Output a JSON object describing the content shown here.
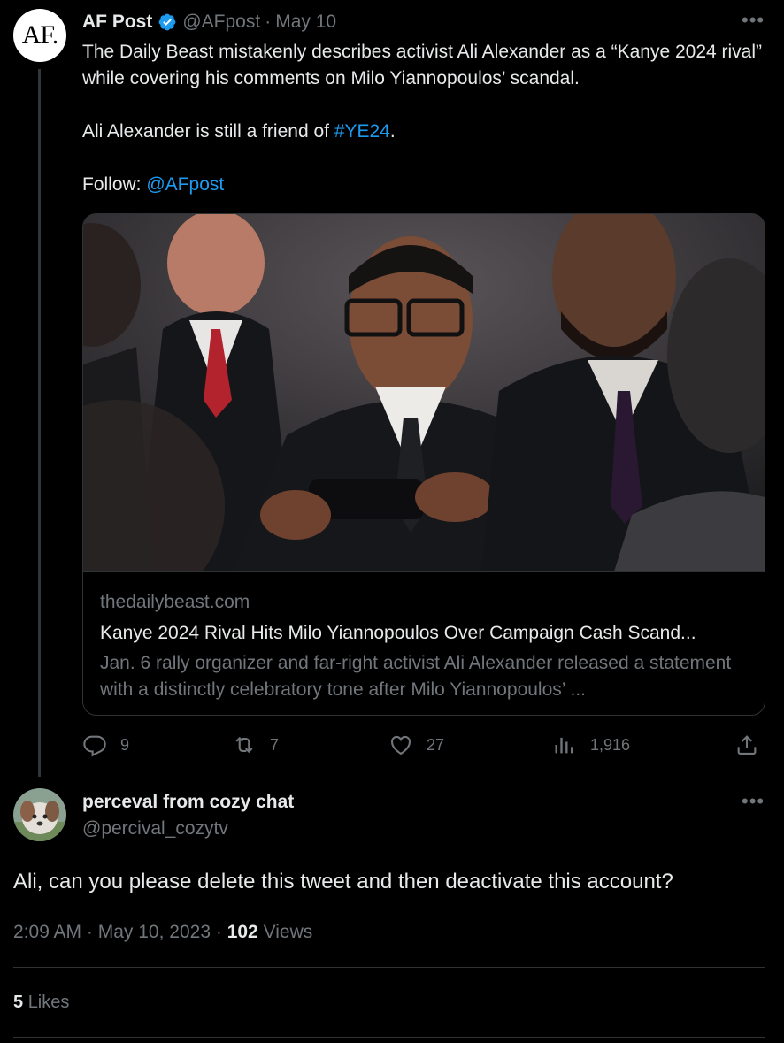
{
  "tweet": {
    "avatar_text": "AF.",
    "author_name": "AF Post",
    "handle": "@AFpost",
    "separator": "·",
    "date": "May 10",
    "more_icon": "more-dots-icon",
    "verified_icon": "verified-badge-icon",
    "verified_color": "#1d9bf0",
    "text_line1": "The Daily Beast mistakenly describes activist Ali Alexander as a “Kanye 2024 rival” while covering his comments on Milo Yiannopoulos’ scandal.",
    "text_line2_prefix": "Ali Alexander is still a friend of ",
    "hashtag": "#YE24",
    "text_line2_suffix": ".",
    "follow_prefix": "Follow: ",
    "follow_handle": "@AFpost",
    "card": {
      "domain": "thedailybeast.com",
      "title": "Kanye 2024 Rival Hits Milo Yiannopoulos Over Campaign Cash Scand...",
      "description": "Jan. 6 rally organizer and far-right activist Ali Alexander released a statement with a distinctly celebratory tone after Milo Yiannopoulos’ ..."
    },
    "actions": {
      "replies": "9",
      "retweets": "7",
      "likes": "27",
      "views": "1,916"
    }
  },
  "reply": {
    "author_name": "perceval from cozy chat",
    "handle": "@percival_cozytv",
    "text": "Ali, can you please delete this tweet and then deactivate this account?",
    "time": "2:09 AM",
    "separator": "·",
    "date": "May 10, 2023",
    "views_count": "102",
    "views_label": "Views",
    "likes_count": "5",
    "likes_label": "Likes"
  },
  "colors": {
    "background": "#000000",
    "text": "#e7e9ea",
    "muted": "#71767b",
    "link": "#1d9bf0",
    "border": "#2f3336"
  }
}
